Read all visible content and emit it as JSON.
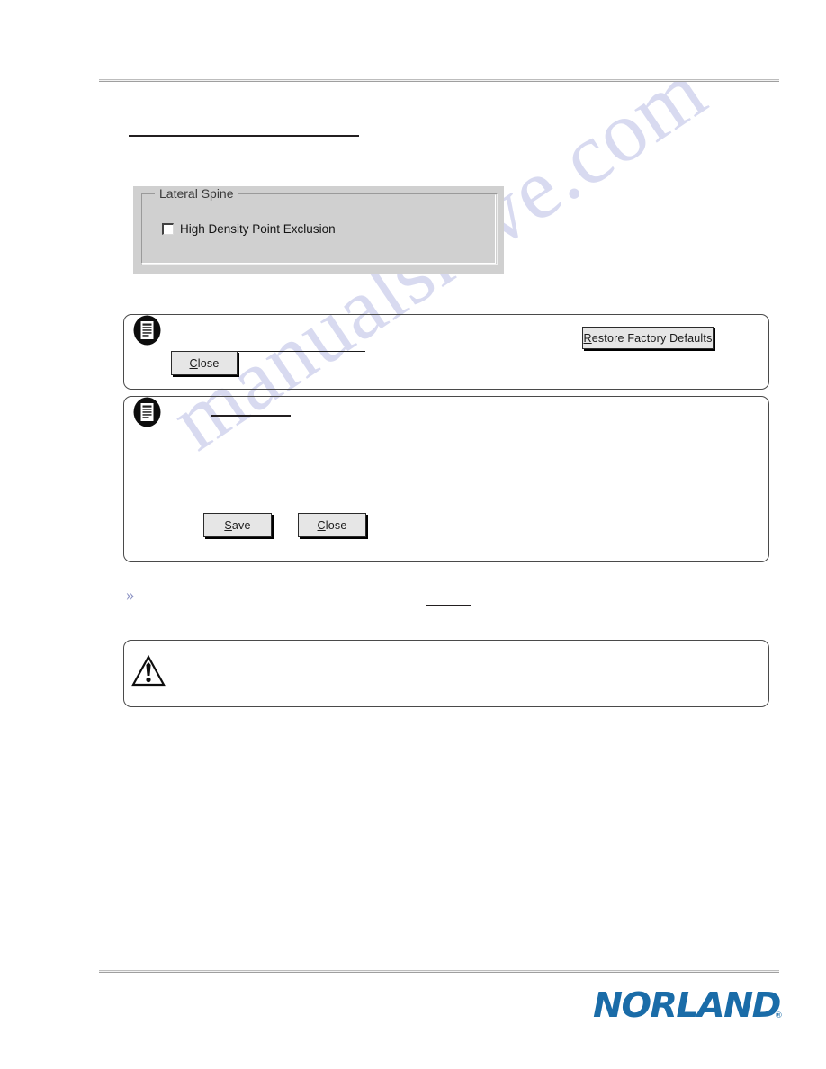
{
  "document": {
    "page_background": "#ffffff",
    "rule_color": "#9f9f9f"
  },
  "watermark": {
    "text": "manualshive.com",
    "color": "#b9bde4"
  },
  "dialog": {
    "name": "Lateral Spine settings dialog",
    "background": "#d0d0d0",
    "groupbox": {
      "title": "Lateral Spine",
      "checkboxes": [
        {
          "label": "High Density Point Exclusion",
          "checked": false
        }
      ]
    }
  },
  "notes": [
    {
      "icon": "note-document-icon",
      "buttons": [
        {
          "label": "Close",
          "accel": "C",
          "prefix": "",
          "suffix": "lose"
        },
        {
          "label": "Restore Factory Defaults",
          "accel": "R",
          "prefix": "",
          "suffix": "estore Factory Defaults"
        }
      ]
    },
    {
      "icon": "note-document-icon",
      "buttons": [
        {
          "label": "Save",
          "accel": "S",
          "prefix": "",
          "suffix": "ave"
        },
        {
          "label": "Close",
          "accel": "C",
          "prefix": "",
          "suffix": "lose"
        }
      ]
    }
  ],
  "buttons": {
    "close_1": {
      "accel": "C",
      "rest": "lose"
    },
    "restore_defaults": {
      "accel": "R",
      "rest": "estore Factory Defaults"
    },
    "save": {
      "accel": "S",
      "rest": "ave"
    },
    "close_2": {
      "accel": "C",
      "rest": "lose"
    }
  },
  "bullet": {
    "marker": "»",
    "color": "#8d94c4"
  },
  "warning": {
    "icon": "warning-triangle-icon"
  },
  "footer": {
    "logo_text": "NORLAND",
    "logo_registered": "®",
    "logo_color": "#1a6ca8"
  }
}
